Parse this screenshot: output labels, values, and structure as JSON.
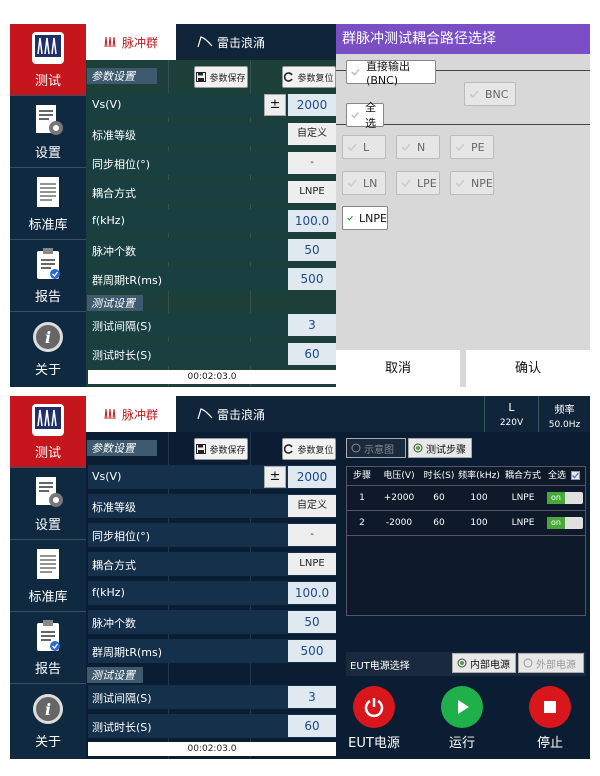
{
  "sidebar": {
    "items": [
      {
        "label": "测试",
        "icon": "waveform-icon"
      },
      {
        "label": "设置",
        "icon": "settings-doc-icon"
      },
      {
        "label": "标准库",
        "icon": "standard-doc-icon"
      },
      {
        "label": "报告",
        "icon": "report-clipboard-icon"
      },
      {
        "label": "关于",
        "icon": "info-icon"
      }
    ]
  },
  "tabs": {
    "burst": "脉冲群",
    "surge": "雷击浪涌"
  },
  "params": {
    "section_title": "参数设置",
    "save_label": "参数保存",
    "reset_label": "参数复位",
    "pm_label": "±",
    "rows": [
      {
        "label": "Vs(V)",
        "value": "2000"
      },
      {
        "label": "标准等级",
        "value": "自定义"
      },
      {
        "label": "同步相位(°)",
        "value": "-"
      },
      {
        "label": "耦合方式",
        "value": "LNPE"
      },
      {
        "label": "f(kHz)",
        "value": "100.0"
      },
      {
        "label": "脉冲个数",
        "value": "50"
      },
      {
        "label": "群周期tR(ms)",
        "value": "500"
      }
    ]
  },
  "test_settings": {
    "section_title": "测试设置",
    "rows": [
      {
        "label": "测试间隔(S)",
        "value": "3"
      },
      {
        "label": "测试时长(S)",
        "value": "60"
      }
    ],
    "elapsed": "00:02:03.0"
  },
  "dialog": {
    "title": "群脉冲测试耦合路径选择",
    "direct_output": "直接输出(BNC)",
    "bnc": "BNC",
    "select_all": "全选",
    "options": [
      "L",
      "N",
      "PE",
      "LN",
      "LPE",
      "NPE",
      "LNPE"
    ],
    "cancel": "取消",
    "confirm": "确认"
  },
  "status": {
    "line": "L",
    "voltage": "220V",
    "freq_label": "频率",
    "freq_value": "50.0Hz"
  },
  "view_tabs": {
    "diagram": "示意图",
    "steps": "测试步骤"
  },
  "steps_table": {
    "headers": [
      "步骤",
      "电压(V)",
      "时长(S)",
      "频率(kHz)",
      "耦合方式",
      "全选"
    ],
    "rows": [
      {
        "step": "1",
        "voltage": "+2000",
        "duration": "60",
        "freq": "100",
        "coupling": "LNPE",
        "state": "on"
      },
      {
        "step": "2",
        "voltage": "-2000",
        "duration": "60",
        "freq": "100",
        "coupling": "LNPE",
        "state": "on"
      }
    ]
  },
  "eut": {
    "label": "EUT电源选择",
    "internal": "内部电源",
    "external": "外部电源"
  },
  "actions": {
    "eut_power": "EUT电源",
    "run": "运行",
    "stop": "停止"
  },
  "colors": {
    "accent_red": "#c4161c",
    "run_green": "#1fb04b",
    "dialog_purple": "#7a4fc6"
  }
}
